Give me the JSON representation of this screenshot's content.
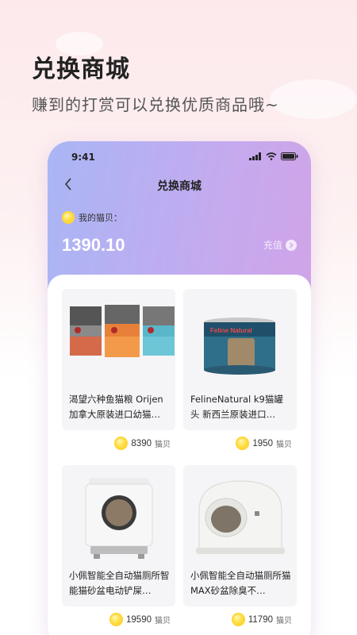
{
  "promo": {
    "title": "兑换商城",
    "subtitle": "赚到的打赏可以兑换优质商品哦~"
  },
  "status_bar": {
    "time": "9:41"
  },
  "nav": {
    "title": "兑换商城"
  },
  "balance": {
    "label": "我的猫贝：",
    "value": "1390.10",
    "recharge_label": "充值"
  },
  "products": [
    {
      "title": "渴望六种鱼猫粮 Orijen加拿大原装进口幼猫…",
      "price": "8390",
      "unit": "猫贝",
      "image": "cat-food-bags"
    },
    {
      "title": "FelineNatural k9猫罐头 新西兰原装进口…",
      "price": "1950",
      "unit": "猫贝",
      "image": "cat-food-can",
      "can_label": "Feline Natural"
    },
    {
      "title": "小佩智能全自动猫厕所智能猫砂盆电动铲屎…",
      "price": "19590",
      "unit": "猫贝",
      "image": "litter-box-square"
    },
    {
      "title": "小佩智能全自动猫厕所猫MAX砂盆除臭不…",
      "price": "11790",
      "unit": "猫贝",
      "image": "litter-box-dome"
    }
  ],
  "colors": {
    "accent_gradient_start": "#a9b6f5",
    "accent_gradient_end": "#d7a1e4",
    "coin": "#ffd53a"
  }
}
